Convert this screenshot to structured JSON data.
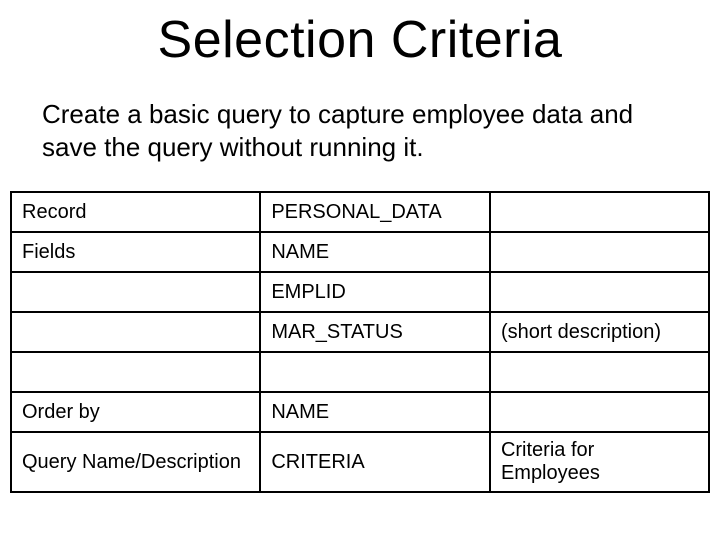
{
  "title": "Selection Criteria",
  "description": "Create a basic query to capture employee data and save the query without running it.",
  "table": {
    "rows": [
      {
        "c1": "Record",
        "c2": "PERSONAL_DATA",
        "c3": ""
      },
      {
        "c1": "Fields",
        "c2": "NAME",
        "c3": ""
      },
      {
        "c1": "",
        "c2": "EMPLID",
        "c3": ""
      },
      {
        "c1": "",
        "c2": "MAR_STATUS",
        "c3": "(short description)"
      },
      {
        "c1": "",
        "c2": "",
        "c3": ""
      },
      {
        "c1": "Order by",
        "c2": "NAME",
        "c3": ""
      },
      {
        "c1": "Query Name/Description",
        "c2": "CRITERIA",
        "c3": "Criteria for Employees"
      }
    ]
  }
}
